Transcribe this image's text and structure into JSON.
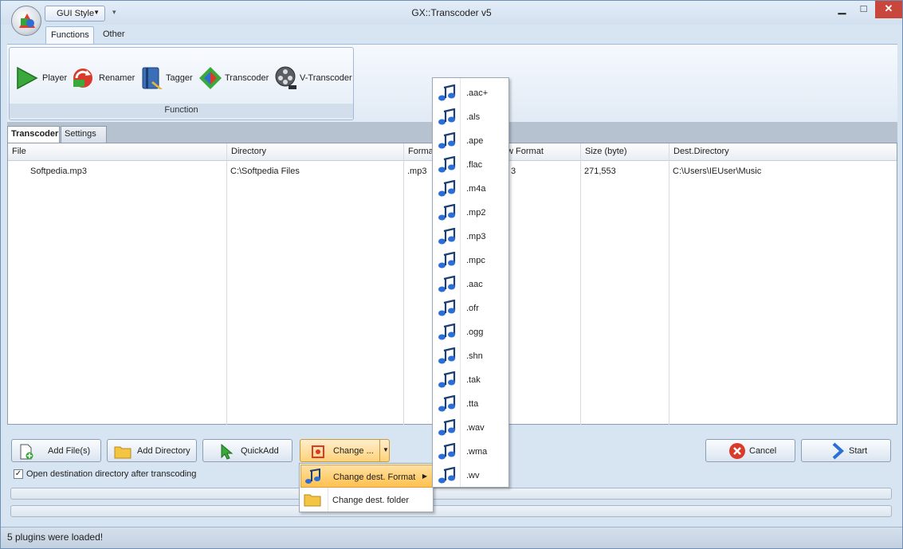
{
  "window": {
    "title": "GX::Transcoder v5"
  },
  "quick_access": {
    "gui_style_label": "GUI Style"
  },
  "ribbon": {
    "tabs": [
      "Functions",
      "Other"
    ],
    "group_label": "Function",
    "buttons": [
      "Player",
      "Renamer",
      "Tagger",
      "Transcoder",
      "V-Transcoder"
    ]
  },
  "doc_tabs": [
    "Transcoder",
    "Settings"
  ],
  "table": {
    "columns": [
      "File",
      "Directory",
      "Format",
      "New Format",
      "Size (byte)",
      "Dest.Directory"
    ],
    "rows": [
      {
        "file": "Softpedia.mp3",
        "directory": "C:\\Softpedia Files",
        "format": ".mp3",
        "new_format": "3",
        "size": "271,553",
        "dest": "C:\\Users\\IEUser\\Music"
      }
    ]
  },
  "actions": {
    "add_files": "Add File(s)",
    "add_directory": "Add Directory",
    "quick_add": "QuickAdd",
    "change": "Change ...",
    "cancel": "Cancel",
    "start": "Start"
  },
  "options": {
    "open_dest_label": "Open destination directory after transcoding",
    "open_dest_checked": true
  },
  "context_menu": {
    "items": [
      "Change dest. Format",
      "Change dest. folder"
    ]
  },
  "format_menu": {
    "items": [
      ".aac+",
      ".als",
      ".ape",
      ".flac",
      ".m4a",
      ".mp2",
      ".mp3",
      ".mpc",
      ".aac",
      ".ofr",
      ".ogg",
      ".shn",
      ".tak",
      ".tta",
      ".wav",
      ".wma",
      ".wv"
    ]
  },
  "statusbar": {
    "text": "5 plugins were loaded!"
  }
}
